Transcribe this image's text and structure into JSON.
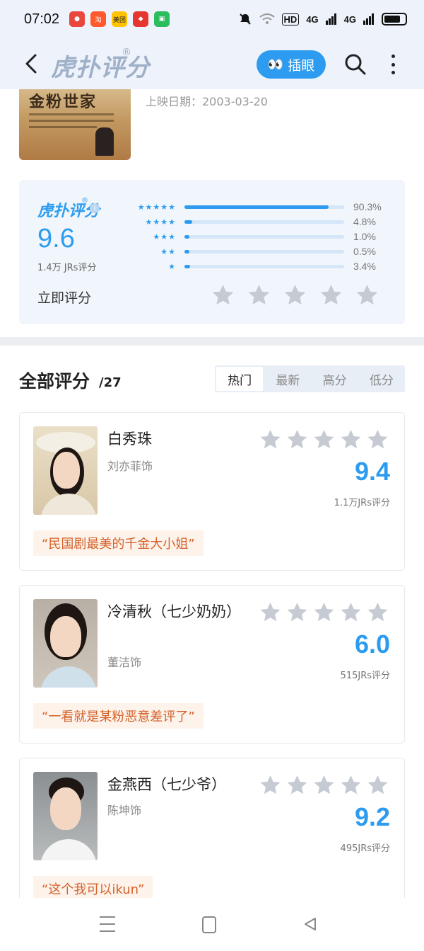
{
  "status_bar": {
    "time": "07:02",
    "apps": [
      {
        "icon": "app-red-icon",
        "label": "",
        "color": "#e9473e"
      },
      {
        "icon": "taobao-icon",
        "label": "淘",
        "color": "#ff5a2c"
      },
      {
        "icon": "meituan-icon",
        "label": "美团",
        "color": "#ffc300"
      },
      {
        "icon": "pinduoduo-icon",
        "label": "",
        "color": "#e5362f"
      },
      {
        "icon": "app-green-icon",
        "label": "",
        "color": "#2cbd5e"
      }
    ],
    "hd_label": "HD",
    "signal1": "4G",
    "signal2": "4G"
  },
  "header": {
    "logo": "虎扑评分",
    "logo_mark": "®",
    "peek_label": "插眼",
    "peek_icon": "👀"
  },
  "show": {
    "poster_title": "金粉世家",
    "release_label": "上映日期：2003-03-20"
  },
  "rating": {
    "logo": "虎扑评分",
    "logo_mark": "®",
    "info_icon": "i",
    "score": "9.6",
    "count": "1.4万 JRs评分",
    "rate_now": "立即评分",
    "distribution": [
      {
        "stars": "★★★★★",
        "pct": "90.3%",
        "value": 0.903
      },
      {
        "stars": "★★★★",
        "pct": "4.8%",
        "value": 0.048
      },
      {
        "stars": "★★★",
        "pct": "1.0%",
        "value": 0.01
      },
      {
        "stars": "★★",
        "pct": "0.5%",
        "value": 0.005
      },
      {
        "stars": "★",
        "pct": "3.4%",
        "value": 0.034
      }
    ]
  },
  "reviews": {
    "title": "全部评分",
    "count": "/27",
    "tabs": [
      "热门",
      "最新",
      "高分",
      "低分"
    ],
    "active_tab": 0
  },
  "characters": [
    {
      "name": "白秀珠",
      "actor": "刘亦菲饰",
      "score": "9.4",
      "votes": "1.1万JRs评分",
      "quote": "“民国剧最美的千金大小姐”"
    },
    {
      "name": "冷清秋（七少奶奶）",
      "actor": "董洁饰",
      "score": "6.0",
      "votes": "515JRs评分",
      "quote": "“一看就是某粉恶意差评了”"
    },
    {
      "name": "金燕西（七少爷）",
      "actor": "陈坤饰",
      "score": "9.2",
      "votes": "495JRs评分",
      "quote": "“这个我可以ikun”"
    }
  ],
  "colors": {
    "accent": "#2d9cf0",
    "quote_text": "#d4612a",
    "quote_bg": "#fdf3ea",
    "star_gray": "#c5cad3"
  }
}
